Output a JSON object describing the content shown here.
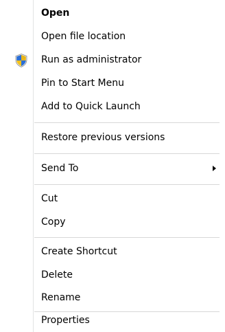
{
  "context_menu": {
    "items": [
      {
        "id": "open",
        "label": "Open"
      },
      {
        "id": "open_file_location",
        "label": "Open file location"
      },
      {
        "id": "run_as_admin",
        "label": "Run as administrator",
        "icon": "uac-shield-icon"
      },
      {
        "id": "pin_start",
        "label": "Pin to Start Menu"
      },
      {
        "id": "quick_launch",
        "label": "Add to Quick Launch"
      },
      {
        "id": "restore_versions",
        "label": "Restore previous versions"
      },
      {
        "id": "send_to",
        "label": "Send To",
        "has_submenu": true
      },
      {
        "id": "cut",
        "label": "Cut"
      },
      {
        "id": "copy",
        "label": "Copy"
      },
      {
        "id": "create_shortcut",
        "label": "Create Shortcut"
      },
      {
        "id": "delete",
        "label": "Delete"
      },
      {
        "id": "rename",
        "label": "Rename"
      },
      {
        "id": "properties",
        "label": "Properties"
      }
    ],
    "colors": {
      "background": "#ffffff",
      "text": "#000000",
      "separator": "#d7d7d7",
      "gutter": "#e2e3e3"
    }
  }
}
